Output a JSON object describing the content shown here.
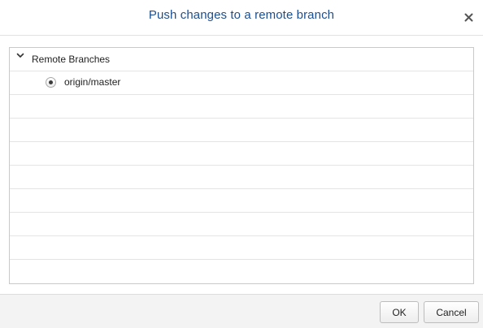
{
  "dialog": {
    "title": "Push changes to a remote branch",
    "close_icon": "close-icon"
  },
  "tree": {
    "group": {
      "label": "Remote Branches",
      "expanded": true,
      "icon": "chevron-down-icon"
    },
    "items": [
      {
        "label": "origin/master",
        "selected": true
      }
    ]
  },
  "footer": {
    "ok_label": "OK",
    "cancel_label": "Cancel"
  }
}
